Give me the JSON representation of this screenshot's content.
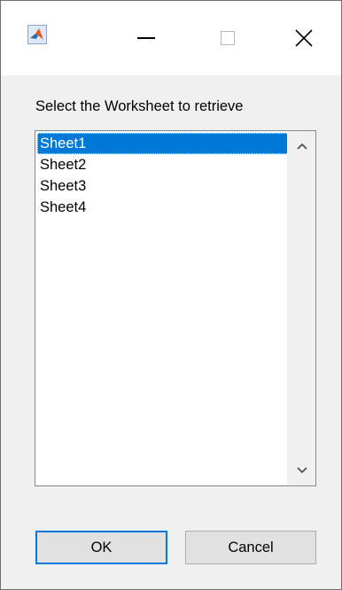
{
  "titlebar": {
    "app_icon": "matlab-icon",
    "minimize_icon": "minimize-icon",
    "maximize_icon": "maximize-icon",
    "close_icon": "close-icon"
  },
  "dialog": {
    "prompt": "Select the Worksheet to retrieve",
    "list_items": [
      {
        "label": "Sheet1",
        "selected": true
      },
      {
        "label": "Sheet2",
        "selected": false
      },
      {
        "label": "Sheet3",
        "selected": false
      },
      {
        "label": "Sheet4",
        "selected": false
      }
    ],
    "scroll_up_icon": "chevron-up-icon",
    "scroll_down_icon": "chevron-down-icon"
  },
  "buttons": {
    "ok_label": "OK",
    "cancel_label": "Cancel"
  },
  "colors": {
    "selection": "#0078d7",
    "selection_text": "#ffffff",
    "dialog_bg": "#f0f0f0",
    "titlebar_bg": "#ffffff",
    "default_button_border": "#0078d7"
  }
}
